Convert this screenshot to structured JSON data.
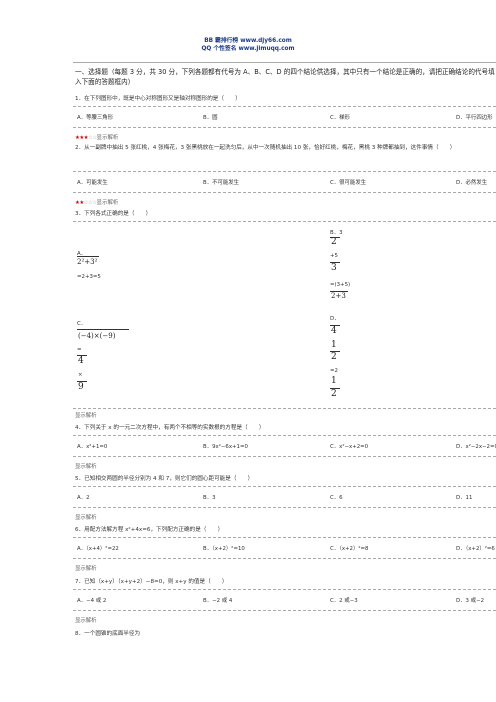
{
  "header": {
    "line1": "BB 霸排行榜 www.djy66.com",
    "line2": "QQ 个性签名 www.jimuqq.com"
  },
  "intro": "一、选择题（每题 3 分，共 30 分，下列各题都有代号为 A、B、C、D 的四个结论供选择，其中只有一个结论是正确的，请把正确结论的代号填入下面的答题框内）",
  "q1": {
    "text": "1．在下列图形中，既是中心对称图形又是轴对称图形的是（　　）",
    "options": [
      "A．等腰三角形",
      "B．圆",
      "C．梯形",
      "D．平行四边形"
    ],
    "stars": "★★★",
    "empty": "☆☆",
    "hint": "显示解析"
  },
  "q2": {
    "text": "2．从一副牌中抽出 5 张红桃，4 张梅花，3 张黑桃放在一起洗匀后，从中一次随机抽出 10 张，恰好红桃，梅花，黑桃 3 种牌都抽到，这件事情（　　）",
    "options": [
      "A．可能发生",
      "B．不可能发生",
      "C．很可能发生",
      "D．必然发生"
    ],
    "stars": "★★",
    "empty": "☆☆☆",
    "hint": "显示解析"
  },
  "q3": {
    "text": "3．下列各式正确的是（　　）",
    "a_label": "A．",
    "a_expr": "2²+3²",
    "a_result": "=2+3=5",
    "b_label": "B．3",
    "b_num1": "2",
    "b_plus": "+5",
    "b_num2": "3",
    "b_eq": "=(3+5)",
    "b_num3": "2+3",
    "c_label": "C．",
    "c_expr": "(−4)×(−9)",
    "c_eq": "=",
    "c_num1": "4",
    "c_times": "×",
    "c_num2": "9",
    "d_label": "D．",
    "d_4": "4",
    "d_1a": "1",
    "d_2a": "2",
    "d_eq": "=2",
    "d_1b": "1",
    "d_2b": "2",
    "hint": "显示解析"
  },
  "q4": {
    "text": "4．下列关于 x 的一元二次方程中，有两个不相等的实数根的方程是（　　）",
    "options": [
      "A．x²+1=0",
      "B．9x²−6x+1=0",
      "C．x²−x+2=0",
      "D．x²−2x−2=0"
    ],
    "hint": "显示解析"
  },
  "q5": {
    "text": "5．已知相交两圆的半径分别为 4 和 7，则它们的圆心距可能是（　　）",
    "options": [
      "A．2",
      "B．3",
      "C．6",
      "D．11"
    ],
    "hint": "显示解析"
  },
  "q6": {
    "text": "6．用配方法解方程 x²+4x=6，下列配方正确的是（　　）",
    "options": [
      "A．（x+4）²=22",
      "B．（x+2）²=10",
      "C．（x+2）²=8",
      "D．（x+2）²=6"
    ],
    "hint": "显示解析"
  },
  "q7": {
    "text": "7．已知（x+y）（x+y+2）−8=0，则 x+y 的值是（　　）",
    "options": [
      "A．−4 或 2",
      "B．−2 或 4",
      "C．2 或−3",
      "D．3 或−2"
    ],
    "hint": "显示解析"
  },
  "q8": {
    "text": "8．一个圆锥的底面半径为"
  }
}
